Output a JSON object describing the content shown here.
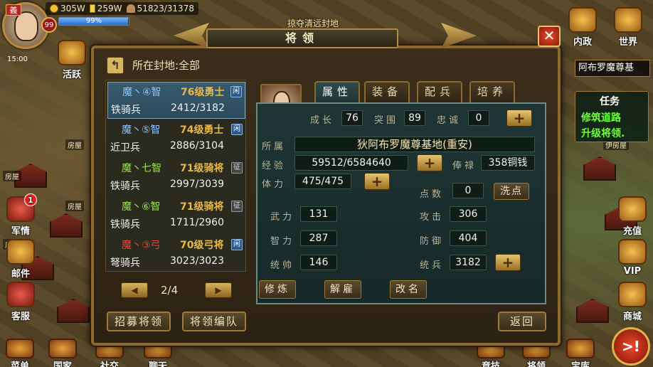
{
  "hud": {
    "avatar_badge": "義",
    "level": "99",
    "gold": "305W",
    "ingot": "259W",
    "troops": "51823/31378",
    "exp_pct": "99%",
    "exp_fraction": 0.99,
    "time": "15:00",
    "banner": "掠夺清远封地"
  },
  "map_labels": [
    "房屋",
    "房屋",
    "房屋",
    "房屋",
    "伊房屋"
  ],
  "left_icons": {
    "active": "活跃",
    "military": "军情",
    "military_count": "1",
    "mail": "邮件",
    "service": "客服"
  },
  "right_icons": {
    "interior": "内政",
    "world": "世界",
    "recharge": "充值",
    "vip": "VIP",
    "shop": "商城"
  },
  "task": {
    "current": "阿布罗魔尊基",
    "title": "任务",
    "line1": "修筑道路",
    "line2": "升级将领."
  },
  "bottom_bar": [
    "菜单",
    "国家",
    "社交",
    "聊天",
    "竞技",
    "将领",
    "宝库"
  ],
  "big_button": ">!",
  "dialog": {
    "title": "将领",
    "close": "✕",
    "fief_label": "所在封地:全部",
    "generals": [
      {
        "name": "魔丶④智",
        "level": "76级勇士",
        "tag": "闲",
        "troop": "铁骑兵",
        "count": "2412/3182"
      },
      {
        "name": "魔丶⑤智",
        "level": "74级勇士",
        "tag": "闲",
        "troop": "近卫兵",
        "count": "2886/3104"
      },
      {
        "name": "魔丶七智",
        "level": "71级骑将",
        "tag": "征",
        "troop": "铁骑兵",
        "count": "2997/3039"
      },
      {
        "name": "魔丶⑥智",
        "level": "71级骑将",
        "tag": "征",
        "troop": "铁骑兵",
        "count": "1711/2960"
      },
      {
        "name": "魔丶③弓",
        "level": "70级弓将",
        "tag": "闲",
        "troop": "弩骑兵",
        "count": "3023/3023"
      }
    ],
    "page": "2/4",
    "recruit_button": "招募将领",
    "formation_button": "将领编队",
    "return_button": "返回",
    "tabs": [
      "属性",
      "装备",
      "配兵",
      "培养"
    ],
    "detail": {
      "growth_label": "成长",
      "growth": "76",
      "assault_label": "突围",
      "assault": "89",
      "loyalty_label": "忠诚",
      "loyalty": "0",
      "belong_label": "所属",
      "belong": "狄阿布罗魔尊基地(重安)",
      "exp_label": "经验",
      "exp": "59512/6584640",
      "salary_label": "俸禄",
      "salary": "358铜钱",
      "stamina_label": "体力",
      "stamina": "475/475",
      "points_label": "点数",
      "points": "0",
      "wash_button": "洗点",
      "force_label": "武力",
      "force": "131",
      "attack_label": "攻击",
      "attack": "306",
      "intel_label": "智力",
      "intel": "287",
      "defense_label": "防御",
      "defense": "404",
      "command_label": "统帅",
      "command": "146",
      "troops_label": "统兵",
      "troops": "3182",
      "train_button": "修炼",
      "dismiss_button": "解雇",
      "rename_button": "改名"
    }
  }
}
